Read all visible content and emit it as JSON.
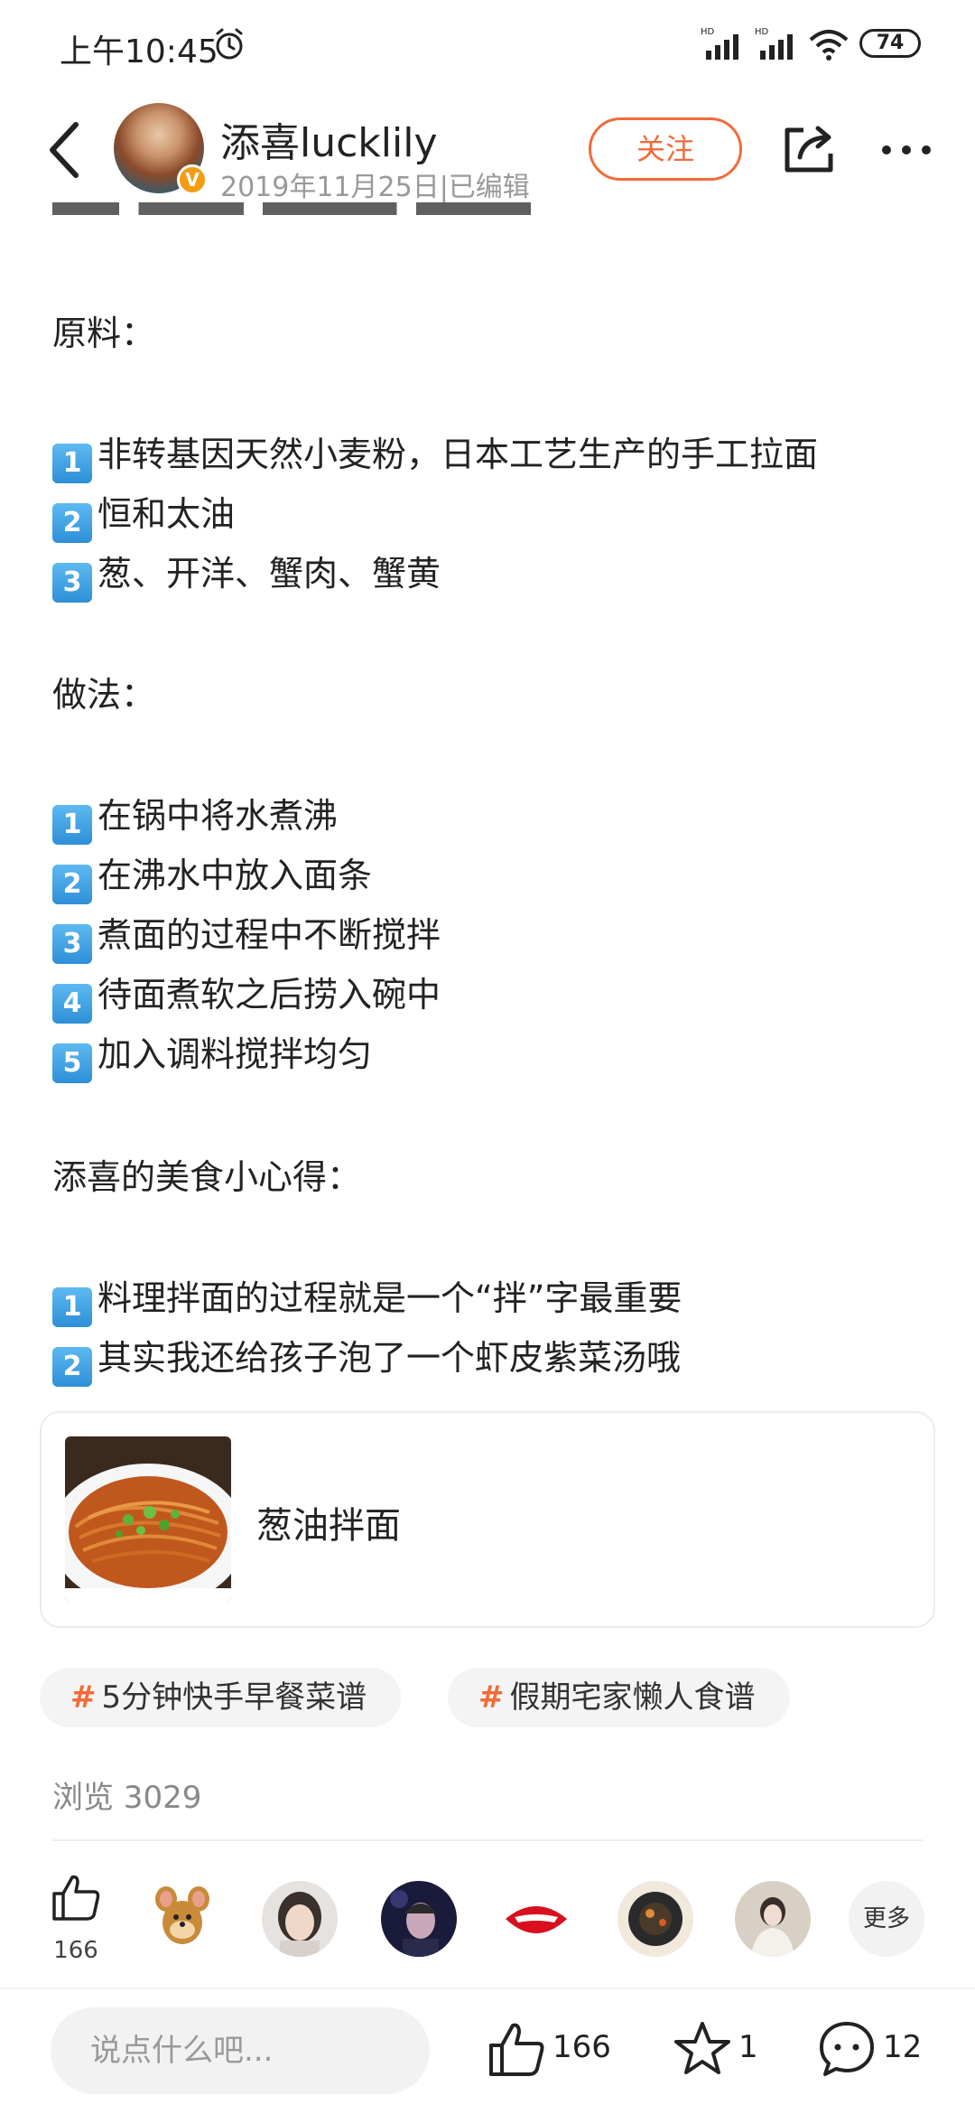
{
  "status_bar": {
    "time": "上午10:45",
    "battery": "74"
  },
  "header": {
    "username": "添喜lucklily",
    "post_date": "2019年11月25日|已编辑",
    "follow_label": "关注",
    "verified_mark": "V"
  },
  "content": {
    "ingredients_heading": "原料：",
    "ingredients": [
      {
        "num": "1",
        "text": "非转基因天然小麦粉，日本工艺生产的手工拉面"
      },
      {
        "num": "2",
        "text": "恒和太油"
      },
      {
        "num": "3",
        "text": "葱、开洋、蟹肉、蟹黄"
      }
    ],
    "method_heading": "做法：",
    "steps": [
      {
        "num": "1",
        "text": "在锅中将水煮沸"
      },
      {
        "num": "2",
        "text": "在沸水中放入面条"
      },
      {
        "num": "3",
        "text": "煮面的过程中不断搅拌"
      },
      {
        "num": "4",
        "text": "待面煮软之后捞入碗中"
      },
      {
        "num": "5",
        "text": "加入调料搅拌均匀"
      }
    ],
    "tips_heading": "添喜的美食小心得：",
    "tips": [
      {
        "num": "1",
        "text": "料理拌面的过程就是一个“拌”字最重要"
      },
      {
        "num": "2",
        "text": "其实我还给孩子泡了一个虾皮紫菜汤哦"
      }
    ]
  },
  "recipe_card": {
    "title": "葱油拌面"
  },
  "topics": [
    {
      "hash": "#",
      "label": "5分钟快手早餐菜谱"
    },
    {
      "hash": "#",
      "label": "假期宅家懒人食谱"
    }
  ],
  "views": "浏览 3029",
  "likers": {
    "count": "166",
    "more_label": "更多"
  },
  "bottom_bar": {
    "comment_placeholder": "说点什么吧...",
    "like_count": "166",
    "favorite_count": "1",
    "comment_count": "12"
  },
  "colors": {
    "accent": "#f26b3a",
    "number_badge": "#3a9ae0",
    "verified": "#f39c12"
  }
}
